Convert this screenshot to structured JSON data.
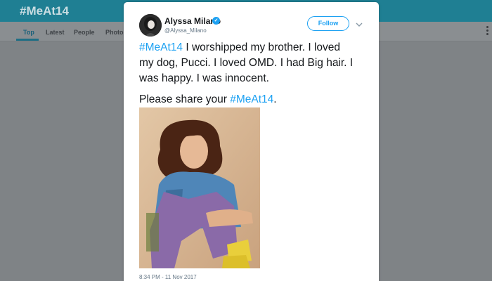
{
  "background_page": {
    "title": "#MeAt14",
    "tabs": [
      {
        "label": "Top",
        "active": true
      },
      {
        "label": "Latest",
        "active": false
      },
      {
        "label": "People",
        "active": false
      },
      {
        "label": "Photos",
        "active": false
      }
    ]
  },
  "tweet": {
    "author": {
      "name": "Alyssa Milano",
      "handle": "@Alyssa_Milano",
      "verified": true
    },
    "follow_label": "Follow",
    "text_lines": [
      {
        "hashtag": "#MeAt14",
        "text": " I worshipped my brother. I loved"
      },
      {
        "text": "my dog, Pucci. I loved OMD. I had Big hair. I"
      },
      {
        "text": "was happy. I was innocent."
      }
    ],
    "share_prefix": "Please share your ",
    "share_hashtag": "#MeAt14",
    "share_suffix": ".",
    "timestamp": "8:34 PM - 11 Nov 2017"
  },
  "colors": {
    "link": "#1da1f2",
    "header_bg": "#1f7f93",
    "overlay_bg": "#7f8386"
  }
}
